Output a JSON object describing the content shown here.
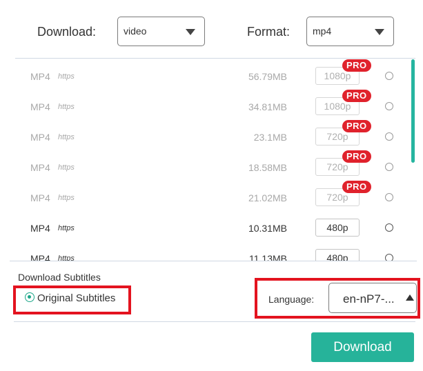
{
  "header": {
    "download_label": "Download:",
    "download_value": "video",
    "format_label": "Format:",
    "format_value": "mp4"
  },
  "formats": [
    {
      "format": "MP4",
      "protocol": "https",
      "size": "56.79MB",
      "resolution": "1080p",
      "badge": "PRO",
      "enabled": false
    },
    {
      "format": "MP4",
      "protocol": "https",
      "size": "34.81MB",
      "resolution": "1080p",
      "badge": "PRO",
      "enabled": false
    },
    {
      "format": "MP4",
      "protocol": "https",
      "size": "23.1MB",
      "resolution": "720p",
      "badge": "PRO",
      "enabled": false
    },
    {
      "format": "MP4",
      "protocol": "https",
      "size": "18.58MB",
      "resolution": "720p",
      "badge": "PRO",
      "enabled": false
    },
    {
      "format": "MP4",
      "protocol": "https",
      "size": "21.02MB",
      "resolution": "720p",
      "badge": "PRO",
      "enabled": false
    },
    {
      "format": "MP4",
      "protocol": "https",
      "size": "10.31MB",
      "resolution": "480p",
      "badge": "",
      "enabled": true
    },
    {
      "format": "MP4",
      "protocol": "https",
      "size": "11.13MB",
      "resolution": "480p",
      "badge": "",
      "enabled": true
    }
  ],
  "subtitles": {
    "section_title": "Download Subtitles",
    "option_label": "Original Subtitles",
    "language_label": "Language:",
    "language_value": "en-nP7-..."
  },
  "footer": {
    "download_button": "Download"
  },
  "colors": {
    "accent": "#26b39a",
    "pro_badge": "#e0222c",
    "highlight_box": "#e3131f"
  }
}
